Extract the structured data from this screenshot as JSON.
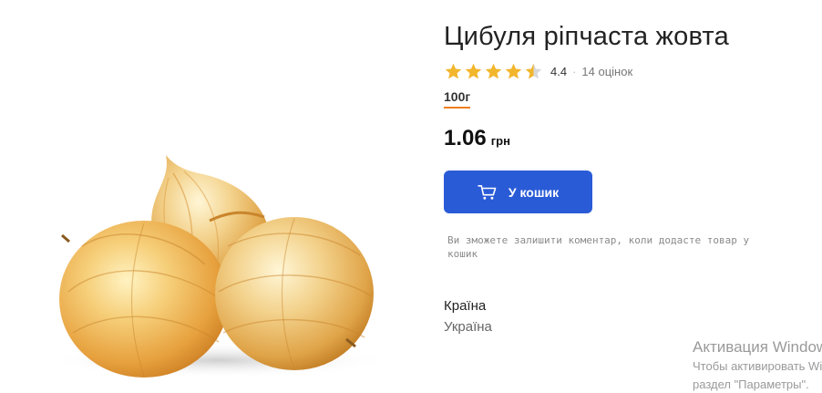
{
  "product": {
    "title": "Цибуля ріпчаста жовта",
    "rating": "4.4",
    "rating_fraction": 0.88,
    "reviews": "14 оцінок",
    "weight": "100г",
    "price": "1.06",
    "currency": "грн",
    "cart_button_label": "У кошик",
    "comment_hint": "Ви зможете залишити коментар, коли додасте товар у кошик",
    "attribute_label": "Країна",
    "attribute_value": "Україна"
  },
  "icons": {
    "star": "star-icon",
    "half_star": "star-half-icon",
    "cart": "cart-icon",
    "image": "onion-image"
  },
  "colors": {
    "accent": "#2a5bd7",
    "star": "#f2b62c",
    "star_empty": "#d8d8d8",
    "weight_underline": "#f07d1a"
  },
  "watermark": {
    "title": "Активация Windows",
    "line1": "Чтобы активировать Windows,",
    "line2": "раздел \"Параметры\"."
  }
}
